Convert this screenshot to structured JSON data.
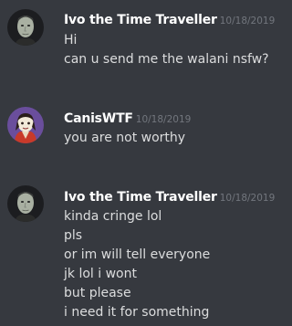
{
  "colors": {
    "background": "#36393f",
    "username": "#ffffff",
    "timestamp": "#72767d",
    "message_text": "#dcddde",
    "canis_avatar_bg": "#6a4e9c"
  },
  "messages": [
    {
      "author": "Ivo the Time Traveller",
      "timestamp": "10/18/2019",
      "avatar_icon": "ivo-avatar-icon",
      "lines": [
        "Hi",
        "can u send me the walani nsfw?"
      ]
    },
    {
      "author": "CanisWTF",
      "timestamp": "10/18/2019",
      "avatar_icon": "caniswtf-avatar-icon",
      "lines": [
        "you are not worthy"
      ]
    },
    {
      "author": "Ivo the Time Traveller",
      "timestamp": "10/18/2019",
      "avatar_icon": "ivo-avatar-icon",
      "lines": [
        "kinda cringe lol",
        "pls",
        "or im will tell everyone",
        "jk lol i wont",
        "but please",
        "i need it for something"
      ]
    }
  ]
}
